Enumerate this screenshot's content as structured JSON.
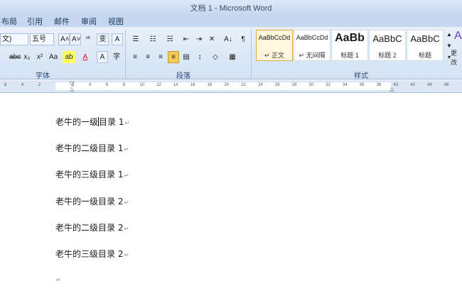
{
  "window": {
    "title": "文档 1 - Microsoft Word"
  },
  "tabs": [
    {
      "label": "布局"
    },
    {
      "label": "引用"
    },
    {
      "label": "邮件"
    },
    {
      "label": "审阅"
    },
    {
      "label": "视图"
    }
  ],
  "ribbon": {
    "font": {
      "font_name": "文)",
      "font_size": "五号",
      "grow": "A˄",
      "shrink": "A˅",
      "clear": "ꟹ",
      "phonetic": "变",
      "border": "A",
      "strike": "abc",
      "subscript": "x₂",
      "superscript": "x²",
      "case": "Aa",
      "highlight": "ab",
      "color": "A",
      "shade": "A",
      "enclose": "字",
      "group_label": "字体"
    },
    "paragraph": {
      "bullets": "☰",
      "numbering": "☷",
      "multilevel": "☵",
      "decrease_indent": "⇤",
      "increase_indent": "⇥",
      "chinese_layout": "✕",
      "sort": "A↓",
      "show_marks": "¶",
      "align_left": "≡",
      "center": "≡",
      "align_right": "≡",
      "justify": "≡",
      "distributed": "▤",
      "line_spacing": "↕",
      "shading": "◇",
      "borders": "▦",
      "group_label": "段落"
    },
    "styles": {
      "cards": [
        {
          "sample": "AaBbCcDd",
          "name": "↵ 正文"
        },
        {
          "sample": "AaBbCcDd",
          "name": "↵ 无间隔"
        },
        {
          "sample": "AaBb",
          "name": "标题 1"
        },
        {
          "sample": "AaBbC",
          "name": "标题 2"
        },
        {
          "sample": "AaBbC",
          "name": "标题"
        }
      ],
      "change_styles": "更改",
      "group_label": "样式"
    }
  },
  "ruler": {
    "ticks": [
      "6",
      "4",
      "2",
      "",
      "2",
      "4",
      "6",
      "8",
      "10",
      "12",
      "14",
      "16",
      "18",
      "20",
      "22",
      "24",
      "26",
      "28",
      "30",
      "32",
      "34",
      "36",
      "38",
      "40",
      "42",
      "44",
      "46"
    ]
  },
  "document": {
    "paragraphs": [
      {
        "before": "老牛的一级",
        "after": "目录 1"
      },
      {
        "text": "老牛的二级目录 1"
      },
      {
        "text": "老牛的三级目录 1"
      },
      {
        "text": "老牛的一级目录 2"
      },
      {
        "text": "老牛的二级目录 2"
      },
      {
        "text": "老牛的三级目录 2"
      },
      {
        "text": ""
      }
    ],
    "para_mark": "↵"
  }
}
